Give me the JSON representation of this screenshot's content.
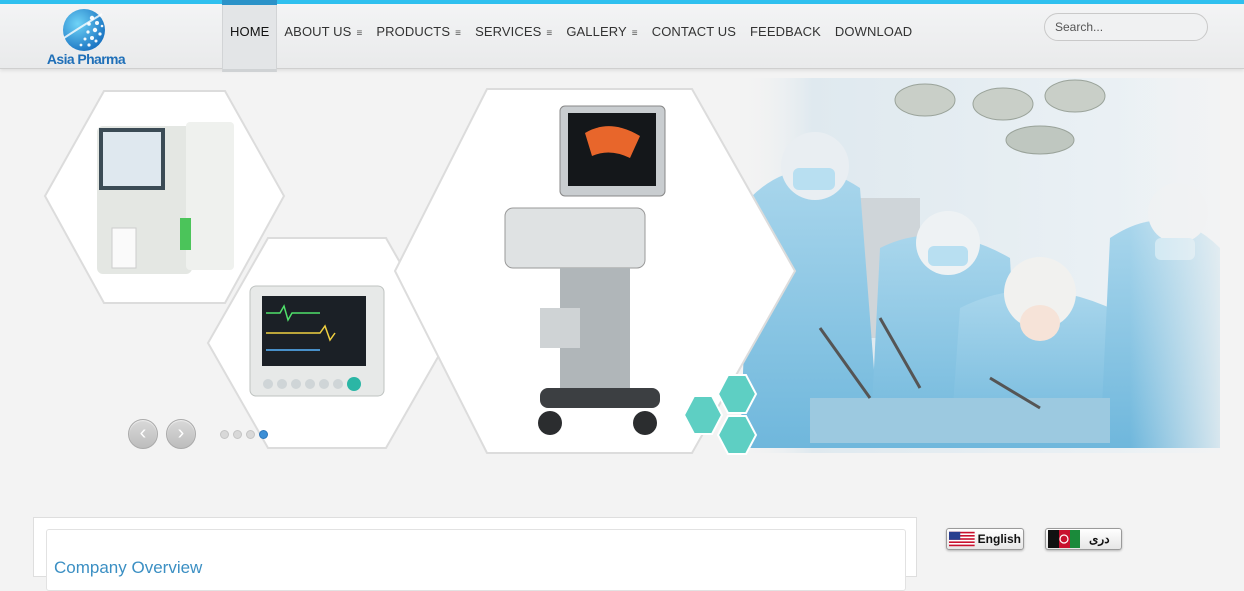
{
  "brand": {
    "name": "Asia Pharma"
  },
  "nav": {
    "items": [
      {
        "label": "HOME",
        "active": true,
        "has_dropdown": false
      },
      {
        "label": "ABOUT US",
        "active": false,
        "has_dropdown": true
      },
      {
        "label": "PRODUCTS",
        "active": false,
        "has_dropdown": true
      },
      {
        "label": "SERVICES",
        "active": false,
        "has_dropdown": true
      },
      {
        "label": "GALLERY",
        "active": false,
        "has_dropdown": true
      },
      {
        "label": "CONTACT US",
        "active": false,
        "has_dropdown": false
      },
      {
        "label": "FEEDBACK",
        "active": false,
        "has_dropdown": false
      },
      {
        "label": "DOWNLOAD",
        "active": false,
        "has_dropdown": false
      }
    ],
    "dropdown_icon": "menu-lines-icon"
  },
  "search": {
    "placeholder": "Search..."
  },
  "slider": {
    "prev_icon": "chevron-left-icon",
    "next_icon": "chevron-right-icon",
    "prev_glyph": "‹",
    "next_glyph": "›",
    "slide_count": 4,
    "active_slide": 4,
    "images": [
      "hematology-analyzer",
      "patient-monitor",
      "ultrasound-machine",
      "surgical-team"
    ]
  },
  "main": {
    "panel_title": "Company Overview"
  },
  "languages": [
    {
      "label": "English",
      "flag": "us-flag-icon"
    },
    {
      "label": "دری",
      "flag": "afghanistan-flag-icon"
    }
  ],
  "colors": {
    "accent": "#2fc0ef",
    "link": "#3b8fc3",
    "brand": "#1f6fb8",
    "active_dot": "#3d8fd6"
  }
}
